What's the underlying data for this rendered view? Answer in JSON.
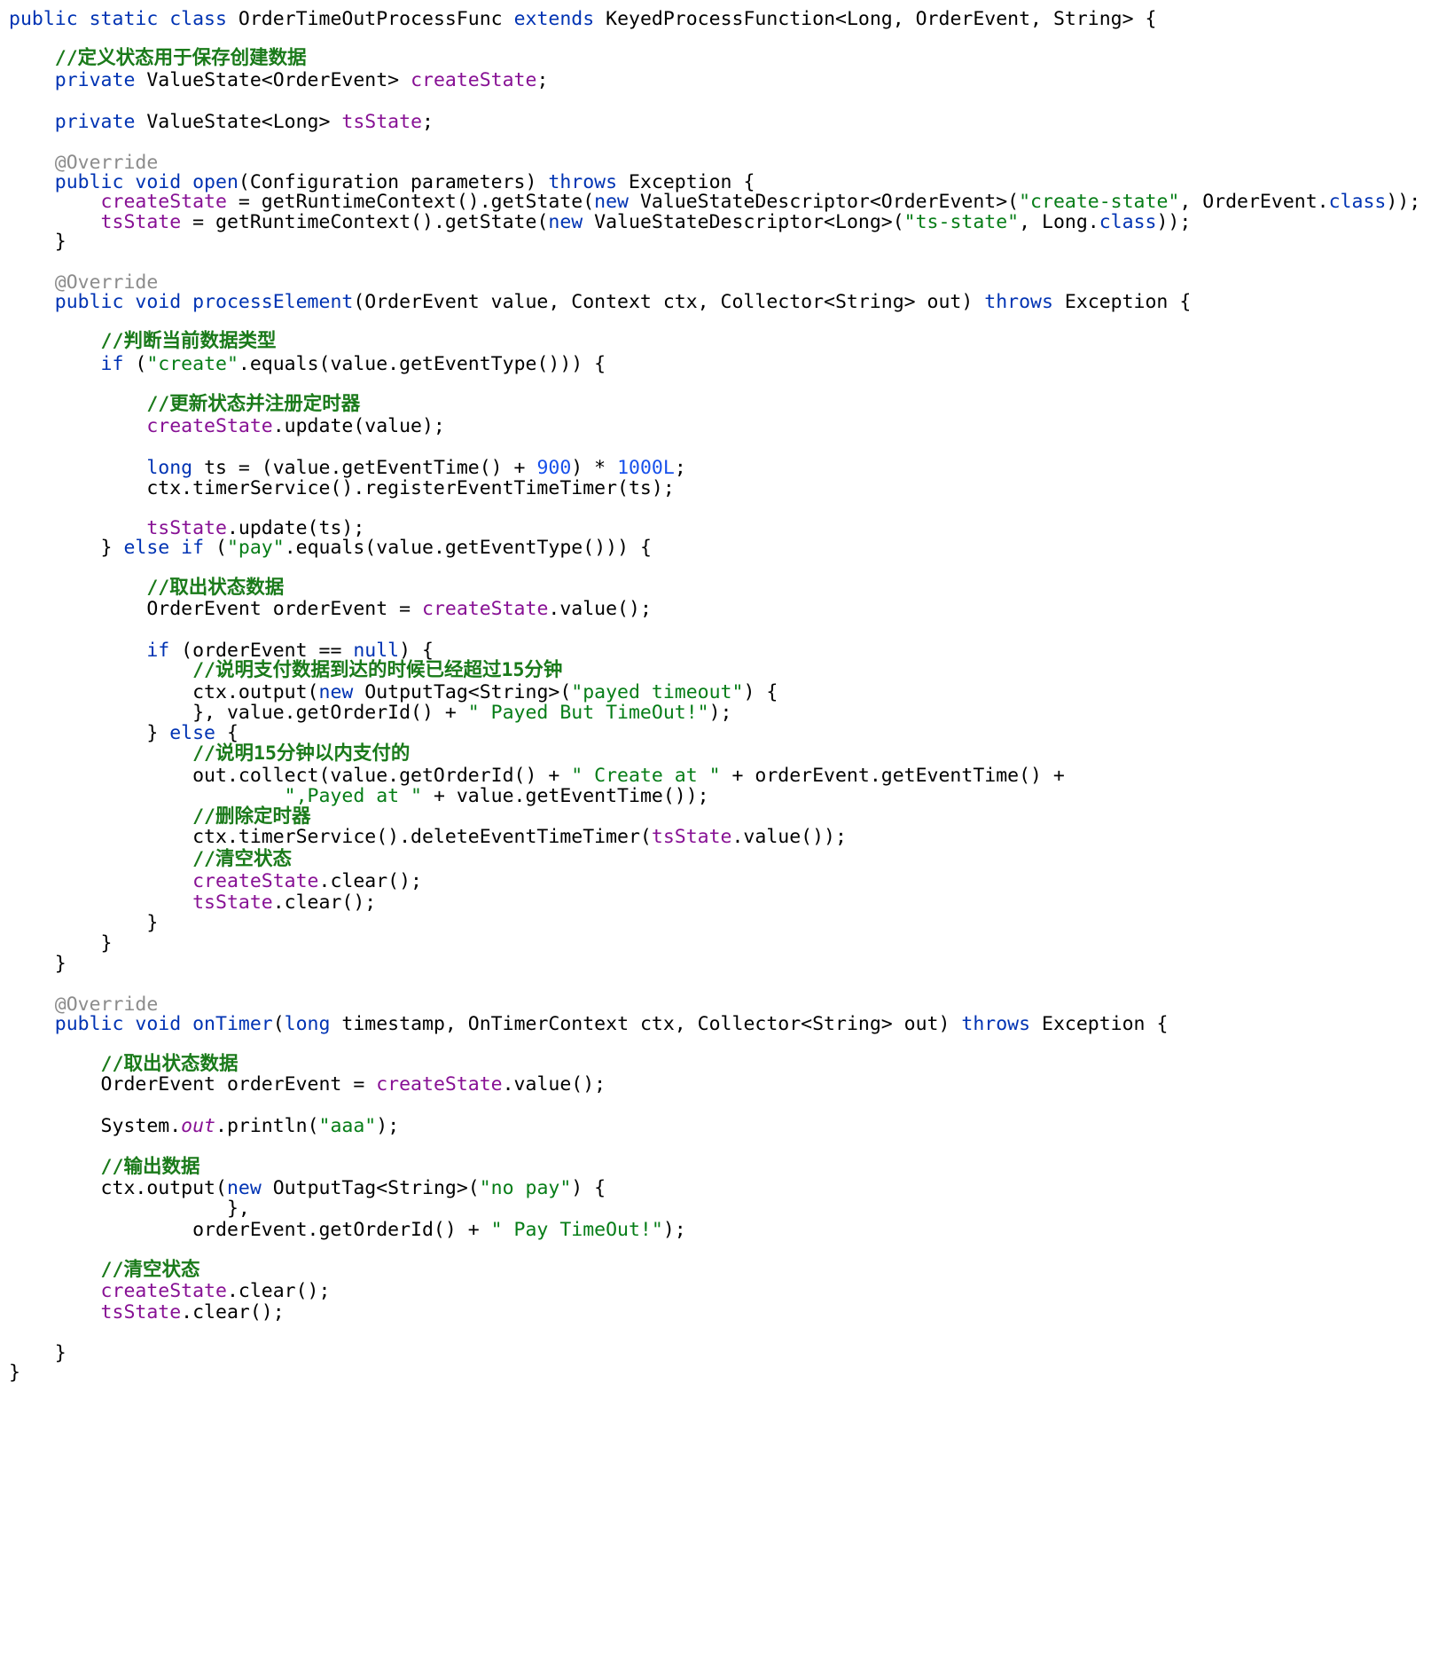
{
  "lines": [
    [
      {
        "t": "kw",
        "s": "public static class "
      },
      {
        "t": "p",
        "s": "OrderTimeOutProcessFunc "
      },
      {
        "t": "kw",
        "s": "extends "
      },
      {
        "t": "p",
        "s": "KeyedProcessFunction<Long, OrderEvent, String> {"
      }
    ],
    [
      {
        "t": "cmt",
        "s": "    //定义状态用于保存创建数据"
      }
    ],
    [
      {
        "t": "kw",
        "s": "    private "
      },
      {
        "t": "p",
        "s": "ValueState<OrderEvent> "
      },
      {
        "t": "fld",
        "s": "createState"
      },
      {
        "t": "p",
        "s": ";"
      }
    ],
    [],
    [
      {
        "t": "kw",
        "s": "    private "
      },
      {
        "t": "p",
        "s": "ValueState<Long> "
      },
      {
        "t": "fld",
        "s": "tsState"
      },
      {
        "t": "p",
        "s": ";"
      }
    ],
    [],
    [
      {
        "t": "ann",
        "s": "    @Override"
      }
    ],
    [
      {
        "t": "kw",
        "s": "    public void "
      },
      {
        "t": "kw",
        "s": "open"
      },
      {
        "t": "p",
        "s": "(Configuration parameters) "
      },
      {
        "t": "kw",
        "s": "throws "
      },
      {
        "t": "p",
        "s": "Exception {"
      }
    ],
    [
      {
        "t": "fld",
        "s": "        createState"
      },
      {
        "t": "p",
        "s": " = getRuntimeContext().getState("
      },
      {
        "t": "kw",
        "s": "new "
      },
      {
        "t": "p",
        "s": "ValueStateDescriptor<OrderEvent>("
      },
      {
        "t": "str",
        "s": "\"create-state\""
      },
      {
        "t": "p",
        "s": ", OrderEvent."
      },
      {
        "t": "kw",
        "s": "class"
      },
      {
        "t": "p",
        "s": "));"
      }
    ],
    [
      {
        "t": "fld",
        "s": "        tsState"
      },
      {
        "t": "p",
        "s": " = getRuntimeContext().getState("
      },
      {
        "t": "kw",
        "s": "new "
      },
      {
        "t": "p",
        "s": "ValueStateDescriptor<Long>("
      },
      {
        "t": "str",
        "s": "\"ts-state\""
      },
      {
        "t": "p",
        "s": ", Long."
      },
      {
        "t": "kw",
        "s": "class"
      },
      {
        "t": "p",
        "s": "));"
      }
    ],
    [
      {
        "t": "p",
        "s": "    }"
      }
    ],
    [],
    [
      {
        "t": "ann",
        "s": "    @Override"
      }
    ],
    [
      {
        "t": "kw",
        "s": "    public void "
      },
      {
        "t": "kw",
        "s": "processElement"
      },
      {
        "t": "p",
        "s": "(OrderEvent value, Context ctx, Collector<String> out) "
      },
      {
        "t": "kw",
        "s": "throws "
      },
      {
        "t": "p",
        "s": "Exception {"
      }
    ],
    [],
    [
      {
        "t": "cmt",
        "s": "        //判断当前数据类型"
      }
    ],
    [
      {
        "t": "kw",
        "s": "        if "
      },
      {
        "t": "p",
        "s": "("
      },
      {
        "t": "str",
        "s": "\"create\""
      },
      {
        "t": "p",
        "s": ".equals(value.getEventType())) {"
      }
    ],
    [],
    [
      {
        "t": "cmt",
        "s": "            //更新状态并注册定时器"
      }
    ],
    [
      {
        "t": "fld",
        "s": "            createState"
      },
      {
        "t": "p",
        "s": ".update(value);"
      }
    ],
    [],
    [
      {
        "t": "kw",
        "s": "            long "
      },
      {
        "t": "p",
        "s": "ts = (value.getEventTime() + "
      },
      {
        "t": "num",
        "s": "900"
      },
      {
        "t": "p",
        "s": ") * "
      },
      {
        "t": "num",
        "s": "1000L"
      },
      {
        "t": "p",
        "s": ";"
      }
    ],
    [
      {
        "t": "p",
        "s": "            ctx.timerService().registerEventTimeTimer(ts);"
      }
    ],
    [],
    [
      {
        "t": "fld",
        "s": "            tsState"
      },
      {
        "t": "p",
        "s": ".update(ts);"
      }
    ],
    [
      {
        "t": "p",
        "s": "        } "
      },
      {
        "t": "kw",
        "s": "else if "
      },
      {
        "t": "p",
        "s": "("
      },
      {
        "t": "str",
        "s": "\"pay\""
      },
      {
        "t": "p",
        "s": ".equals(value.getEventType())) {"
      }
    ],
    [],
    [
      {
        "t": "cmt",
        "s": "            //取出状态数据"
      }
    ],
    [
      {
        "t": "p",
        "s": "            OrderEvent orderEvent = "
      },
      {
        "t": "fld",
        "s": "createState"
      },
      {
        "t": "p",
        "s": ".value();"
      }
    ],
    [],
    [
      {
        "t": "kw",
        "s": "            if "
      },
      {
        "t": "p",
        "s": "(orderEvent == "
      },
      {
        "t": "kw",
        "s": "null"
      },
      {
        "t": "p",
        "s": ") {"
      }
    ],
    [
      {
        "t": "cmt",
        "s": "                //说明支付数据到达的时候已经超过15分钟"
      }
    ],
    [
      {
        "t": "p",
        "s": "                ctx.output("
      },
      {
        "t": "kw",
        "s": "new "
      },
      {
        "t": "p",
        "s": "OutputTag<String>("
      },
      {
        "t": "str",
        "s": "\"payed timeout\""
      },
      {
        "t": "p",
        "s": ") {"
      }
    ],
    [
      {
        "t": "p",
        "s": "                }, value.getOrderId() + "
      },
      {
        "t": "str",
        "s": "\" Payed But TimeOut!\""
      },
      {
        "t": "p",
        "s": ");"
      }
    ],
    [
      {
        "t": "p",
        "s": "            } "
      },
      {
        "t": "kw",
        "s": "else "
      },
      {
        "t": "p",
        "s": "{"
      }
    ],
    [
      {
        "t": "cmt",
        "s": "                //说明15分钟以内支付的"
      }
    ],
    [
      {
        "t": "p",
        "s": "                out.collect(value.getOrderId() + "
      },
      {
        "t": "str",
        "s": "\" Create at \""
      },
      {
        "t": "p",
        "s": " + orderEvent.getEventTime() +"
      }
    ],
    [
      {
        "t": "str",
        "s": "                        \",Payed at \""
      },
      {
        "t": "p",
        "s": " + value.getEventTime());"
      }
    ],
    [
      {
        "t": "cmt",
        "s": "                //删除定时器"
      }
    ],
    [
      {
        "t": "p",
        "s": "                ctx.timerService().deleteEventTimeTimer("
      },
      {
        "t": "fld",
        "s": "tsState"
      },
      {
        "t": "p",
        "s": ".value());"
      }
    ],
    [
      {
        "t": "cmt",
        "s": "                //清空状态"
      }
    ],
    [
      {
        "t": "fld",
        "s": "                createState"
      },
      {
        "t": "p",
        "s": ".clear();"
      }
    ],
    [
      {
        "t": "fld",
        "s": "                tsState"
      },
      {
        "t": "p",
        "s": ".clear();"
      }
    ],
    [
      {
        "t": "p",
        "s": "            }"
      }
    ],
    [
      {
        "t": "p",
        "s": "        }"
      }
    ],
    [
      {
        "t": "p",
        "s": "    }"
      }
    ],
    [],
    [
      {
        "t": "ann",
        "s": "    @Override"
      }
    ],
    [
      {
        "t": "kw",
        "s": "    public void "
      },
      {
        "t": "kw",
        "s": "onTimer"
      },
      {
        "t": "p",
        "s": "("
      },
      {
        "t": "kw",
        "s": "long "
      },
      {
        "t": "p",
        "s": "timestamp, OnTimerContext ctx, Collector<String> out) "
      },
      {
        "t": "kw",
        "s": "throws "
      },
      {
        "t": "p",
        "s": "Exception {"
      }
    ],
    [],
    [
      {
        "t": "cmt",
        "s": "        //取出状态数据"
      }
    ],
    [
      {
        "t": "p",
        "s": "        OrderEvent orderEvent = "
      },
      {
        "t": "fld",
        "s": "createState"
      },
      {
        "t": "p",
        "s": ".value();"
      }
    ],
    [],
    [
      {
        "t": "p",
        "s": "        System."
      },
      {
        "t": "stat",
        "s": "out"
      },
      {
        "t": "p",
        "s": ".println("
      },
      {
        "t": "str",
        "s": "\"aaa\""
      },
      {
        "t": "p",
        "s": ");"
      }
    ],
    [],
    [
      {
        "t": "cmt",
        "s": "        //输出数据"
      }
    ],
    [
      {
        "t": "p",
        "s": "        ctx.output("
      },
      {
        "t": "kw",
        "s": "new "
      },
      {
        "t": "p",
        "s": "OutputTag<String>("
      },
      {
        "t": "str",
        "s": "\"no pay\""
      },
      {
        "t": "p",
        "s": ") {"
      }
    ],
    [
      {
        "t": "p",
        "s": "                   },"
      }
    ],
    [
      {
        "t": "p",
        "s": "                orderEvent.getOrderId() + "
      },
      {
        "t": "str",
        "s": "\" Pay TimeOut!\""
      },
      {
        "t": "p",
        "s": ");"
      }
    ],
    [],
    [
      {
        "t": "cmt",
        "s": "        //清空状态"
      }
    ],
    [
      {
        "t": "fld",
        "s": "        createState"
      },
      {
        "t": "p",
        "s": ".clear();"
      }
    ],
    [
      {
        "t": "fld",
        "s": "        tsState"
      },
      {
        "t": "p",
        "s": ".clear();"
      }
    ],
    [],
    [
      {
        "t": "p",
        "s": "    }"
      }
    ],
    [
      {
        "t": "p",
        "s": "}"
      }
    ]
  ]
}
